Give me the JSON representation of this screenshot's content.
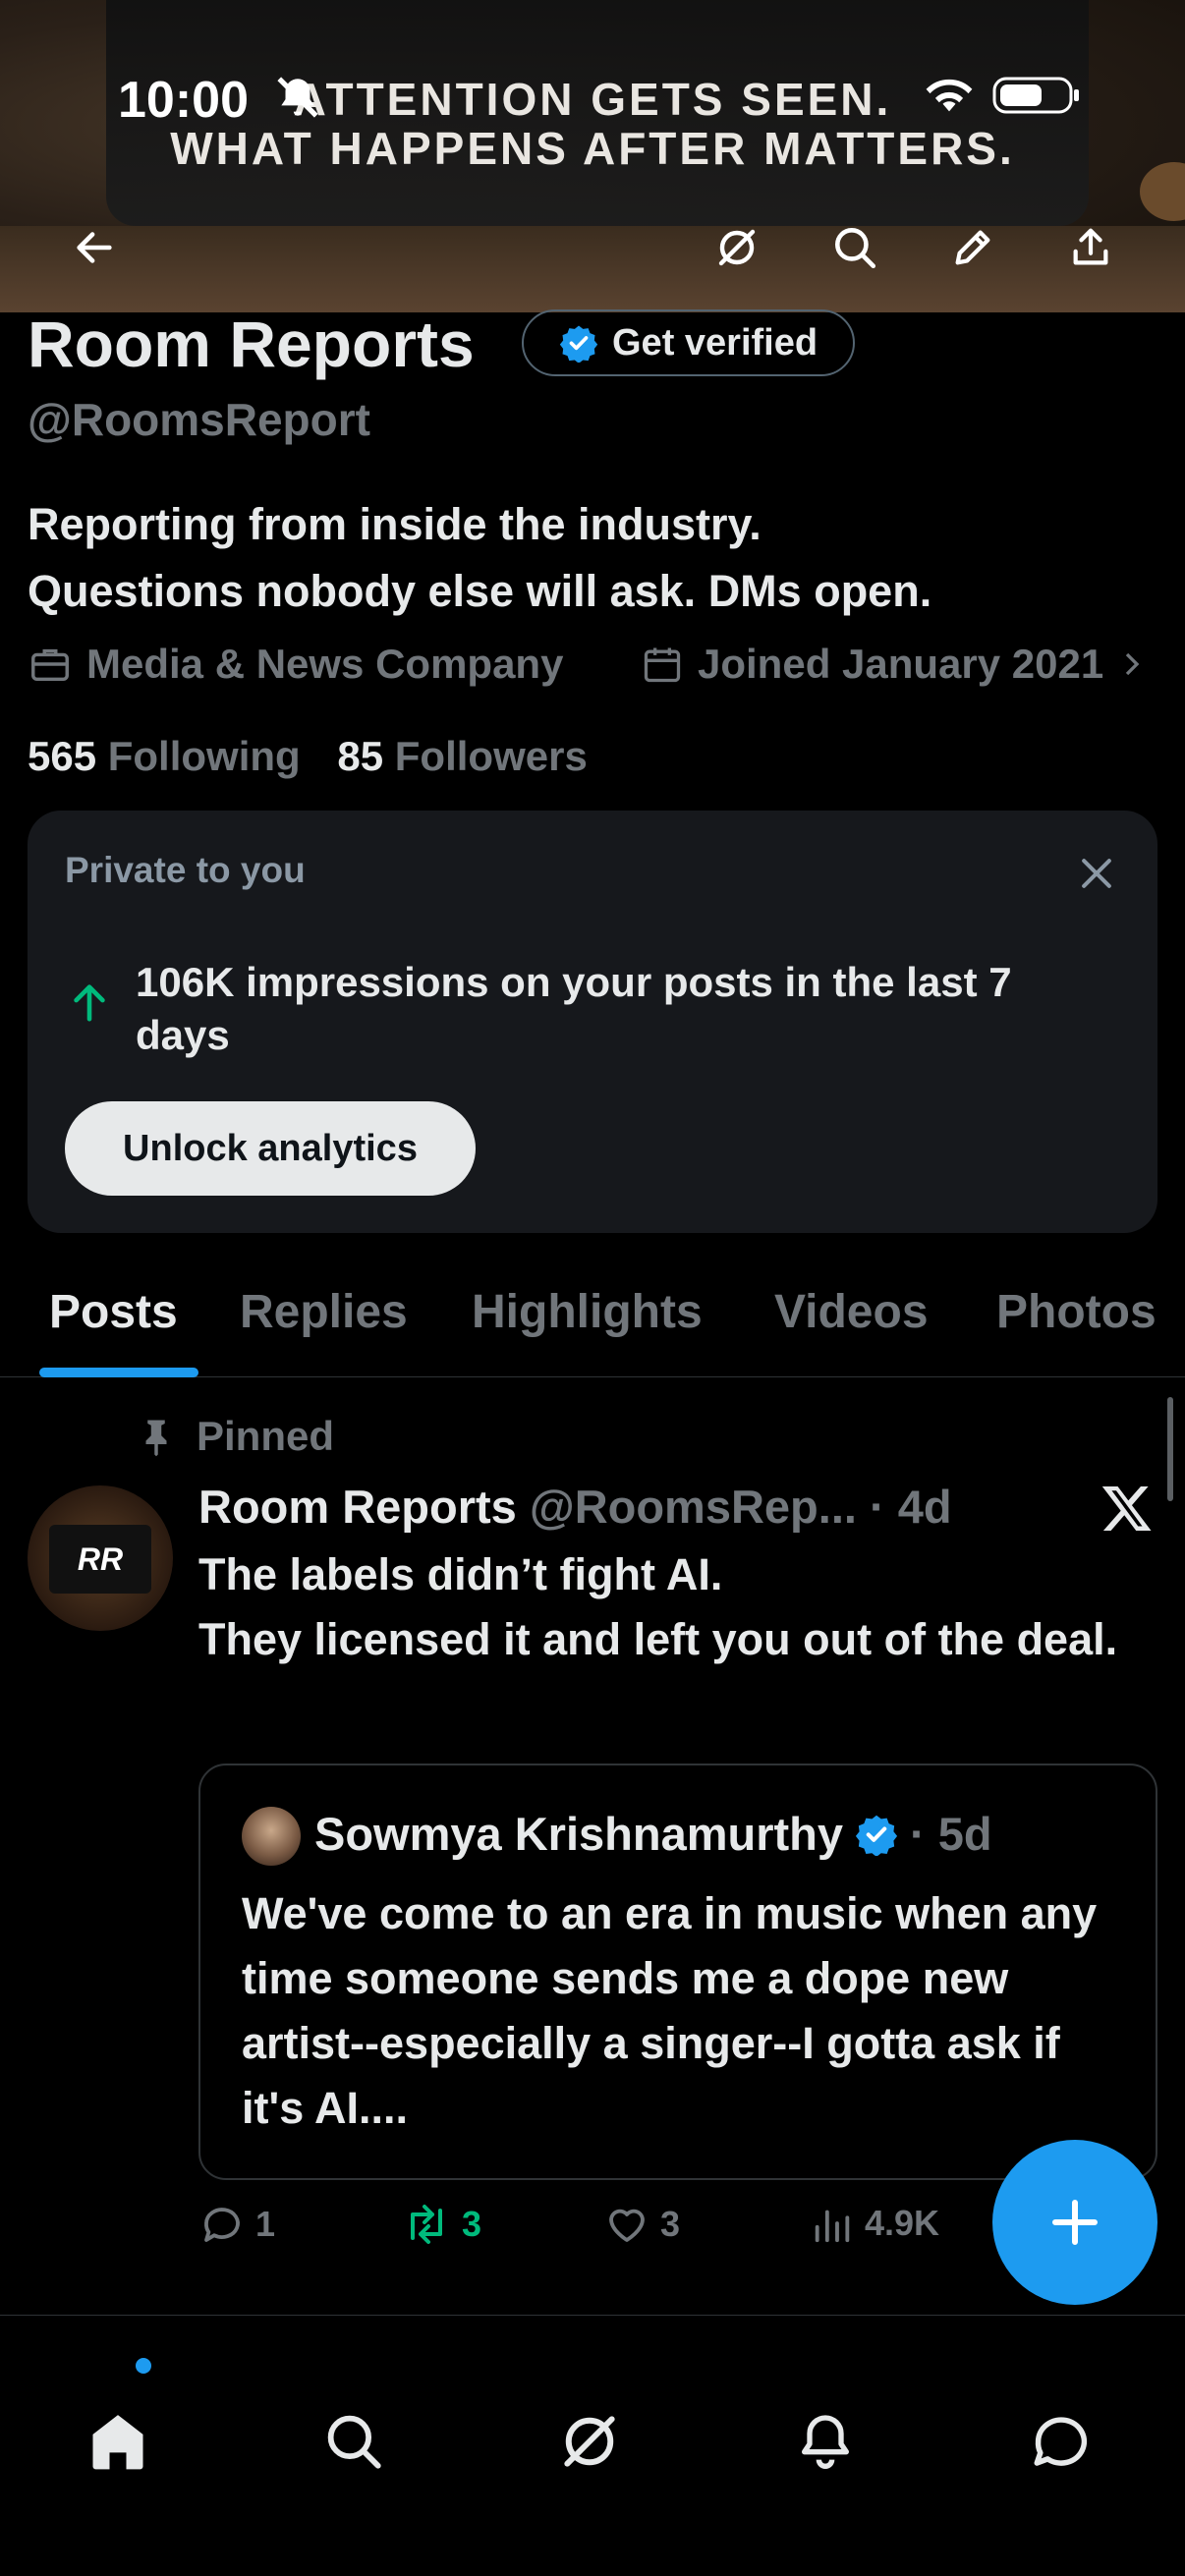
{
  "status_bar": {
    "time": "10:00"
  },
  "banner": {
    "line1": "ATTENTION GETS SEEN.",
    "line2": "WHAT HAPPENS AFTER MATTERS."
  },
  "profile": {
    "name": "Room Reports",
    "get_verified_label": "Get verified",
    "handle": "@RoomsReport",
    "bio_line1": "Reporting from inside the industry.",
    "bio_line2": "Questions nobody else will ask. DMs open.",
    "category": "Media & News Company",
    "joined": "Joined January 2021",
    "following_count": "565",
    "following_label": "Following",
    "followers_count": "85",
    "followers_label": "Followers"
  },
  "analytics_card": {
    "private_label": "Private to you",
    "impressions_text": "106K impressions on your posts in the last 7 days",
    "unlock_label": "Unlock analytics"
  },
  "tabs": [
    {
      "label": "Posts",
      "active": true
    },
    {
      "label": "Replies"
    },
    {
      "label": "Highlights"
    },
    {
      "label": "Videos"
    },
    {
      "label": "Photos"
    }
  ],
  "post": {
    "pinned_label": "Pinned",
    "author_name": "Room Reports",
    "author_handle": "@RoomsRep...",
    "age": "· 4d",
    "avatar_text": "RR",
    "text_line1": "The labels didn’t fight AI.",
    "text_line2": "They licensed it and left you out of the deal.",
    "quote": {
      "author_name": "Sowmya Krishnamurthy",
      "age": "· 5d",
      "text": "We've come to an era in music when any time someone sends me a dope new artist--especially a singer--I gotta ask if it's AI...."
    },
    "replies": "1",
    "reposts": "3",
    "likes": "3",
    "views": "4.9K"
  },
  "colors": {
    "accent": "#1d9bf0",
    "repost_green": "#00ba7c",
    "muted": "#71767b",
    "background": "#000000"
  }
}
